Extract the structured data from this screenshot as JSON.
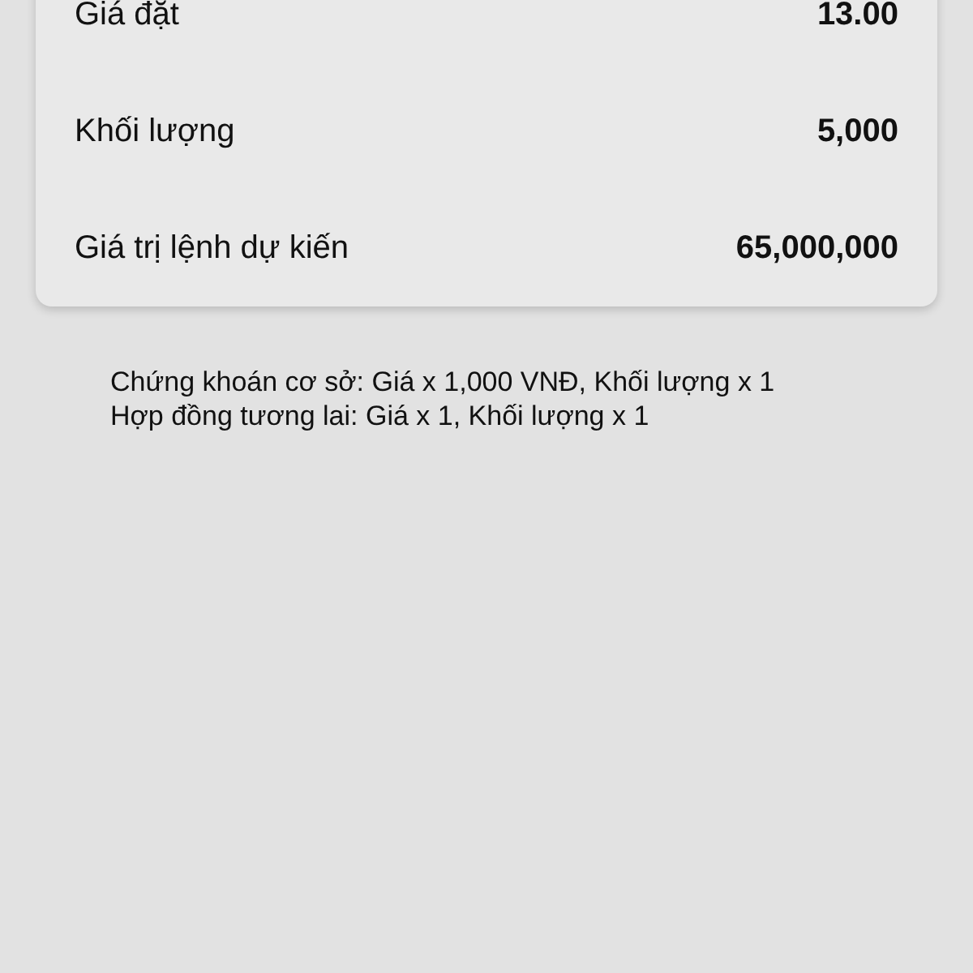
{
  "order_summary": {
    "rows": [
      {
        "label": "Giá đặt",
        "value": "13.00"
      },
      {
        "label": "Khối lượng",
        "value": "5,000"
      },
      {
        "label": "Giá trị lệnh dự kiến",
        "value": "65,000,000"
      }
    ]
  },
  "notes": [
    "Chứng khoán cơ sở: Giá x 1,000 VNĐ, Khối lượng x 1",
    "Hợp đồng tương lai: Giá x 1, Khối lượng x 1"
  ]
}
